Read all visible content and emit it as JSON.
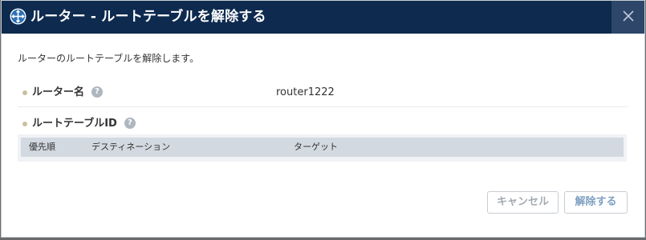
{
  "dialog": {
    "title": "ルーター - ルートテーブルを解除する",
    "description": "ルーターのルートテーブルを解除します。"
  },
  "fields": {
    "router_name_label": "ルーター名",
    "router_name_value": "router1222",
    "route_table_id_label": "ルートテーブルID",
    "help_glyph": "?"
  },
  "table": {
    "columns": [
      "優先順",
      "デスティネーション",
      "ターゲット"
    ]
  },
  "buttons": {
    "cancel": "キャンセル",
    "release": "解除する"
  },
  "colors": {
    "titlebar": "#0e2a4f",
    "accent": "#7e9fc0"
  }
}
